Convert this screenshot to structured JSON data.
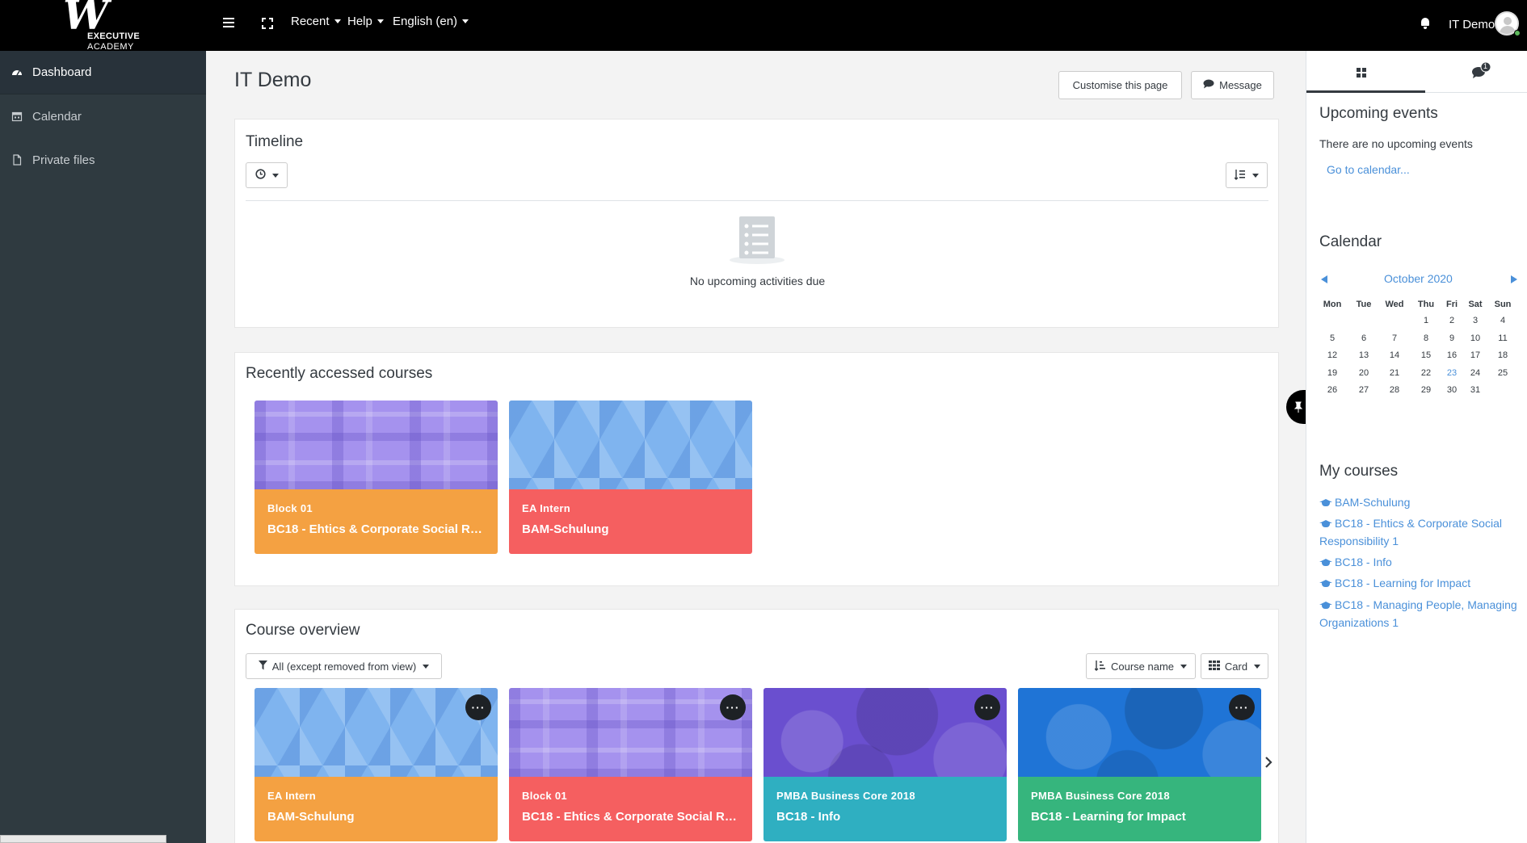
{
  "navbar": {
    "logo_mark": "W",
    "logo_line1": "EXECUTIVE",
    "logo_line2": "ACADEMY",
    "recent": "Recent",
    "help": "Help",
    "language": "English (en)",
    "user_name": "IT Demo"
  },
  "drawer": {
    "items": [
      {
        "label": "Dashboard",
        "icon": "dashboard-icon"
      },
      {
        "label": "Calendar",
        "icon": "calendar-icon"
      },
      {
        "label": "Private files",
        "icon": "file-icon"
      }
    ]
  },
  "page": {
    "title": "IT Demo",
    "customise_label": "Customise this page",
    "message_label": "Message"
  },
  "timeline": {
    "title": "Timeline",
    "empty_text": "No upcoming activities due"
  },
  "recent_courses": {
    "title": "Recently accessed courses",
    "courses": [
      {
        "category": "Block 01",
        "name": "BC18 - Ehtics & Corporate Social Responsibility 1",
        "color": "#f4a142",
        "pattern": "plaid"
      },
      {
        "category": "EA Intern",
        "name": "BAM-Schulung",
        "color": "#f55f60",
        "pattern": "hex"
      }
    ]
  },
  "course_overview": {
    "title": "Course overview",
    "filter_label": "All (except removed from view)",
    "sort_label": "Course name",
    "view_label": "Card",
    "courses": [
      {
        "category": "EA Intern",
        "name": "BAM-Schulung",
        "color": "#f4a142",
        "pattern": "hex"
      },
      {
        "category": "Block 01",
        "name": "BC18 - Ehtics & Corporate Social Responsibility 1",
        "color": "#f55f60",
        "pattern": "plaid"
      },
      {
        "category": "PMBA Business Core 2018",
        "name": "BC18 - Info",
        "color": "#2fafc1",
        "pattern": "circles"
      },
      {
        "category": "PMBA Business Core 2018",
        "name": "BC18 - Learning for Impact",
        "color": "#36b57d",
        "pattern": "blue-circles"
      }
    ]
  },
  "right_drawer": {
    "upcoming_title": "Upcoming events",
    "upcoming_empty": "There are no upcoming events",
    "goto_calendar": "Go to calendar...",
    "calendar_title": "Calendar",
    "month": "October 2020",
    "weekdays": [
      "Mon",
      "Tue",
      "Wed",
      "Thu",
      "Fri",
      "Sat",
      "Sun"
    ],
    "weeks": [
      [
        "",
        "",
        "",
        "1",
        "2",
        "3",
        "4"
      ],
      [
        "5",
        "6",
        "7",
        "8",
        "9",
        "10",
        "11"
      ],
      [
        "12",
        "13",
        "14",
        "15",
        "16",
        "17",
        "18"
      ],
      [
        "19",
        "20",
        "21",
        "22",
        "23",
        "24",
        "25"
      ],
      [
        "26",
        "27",
        "28",
        "29",
        "30",
        "31",
        ""
      ]
    ],
    "today": "23",
    "mycourses_title": "My courses",
    "mycourses": [
      "BAM-Schulung",
      "BC18 - Ehtics & Corporate Social Responsibility 1",
      "BC18 - Info",
      "BC18 - Learning for Impact",
      "BC18 - Managing People, Managing Organizations 1"
    ],
    "message_badge": "1"
  },
  "colors": {
    "navbar": "#000000",
    "drawer": "#2f3a40",
    "link": "#4a90d9"
  }
}
